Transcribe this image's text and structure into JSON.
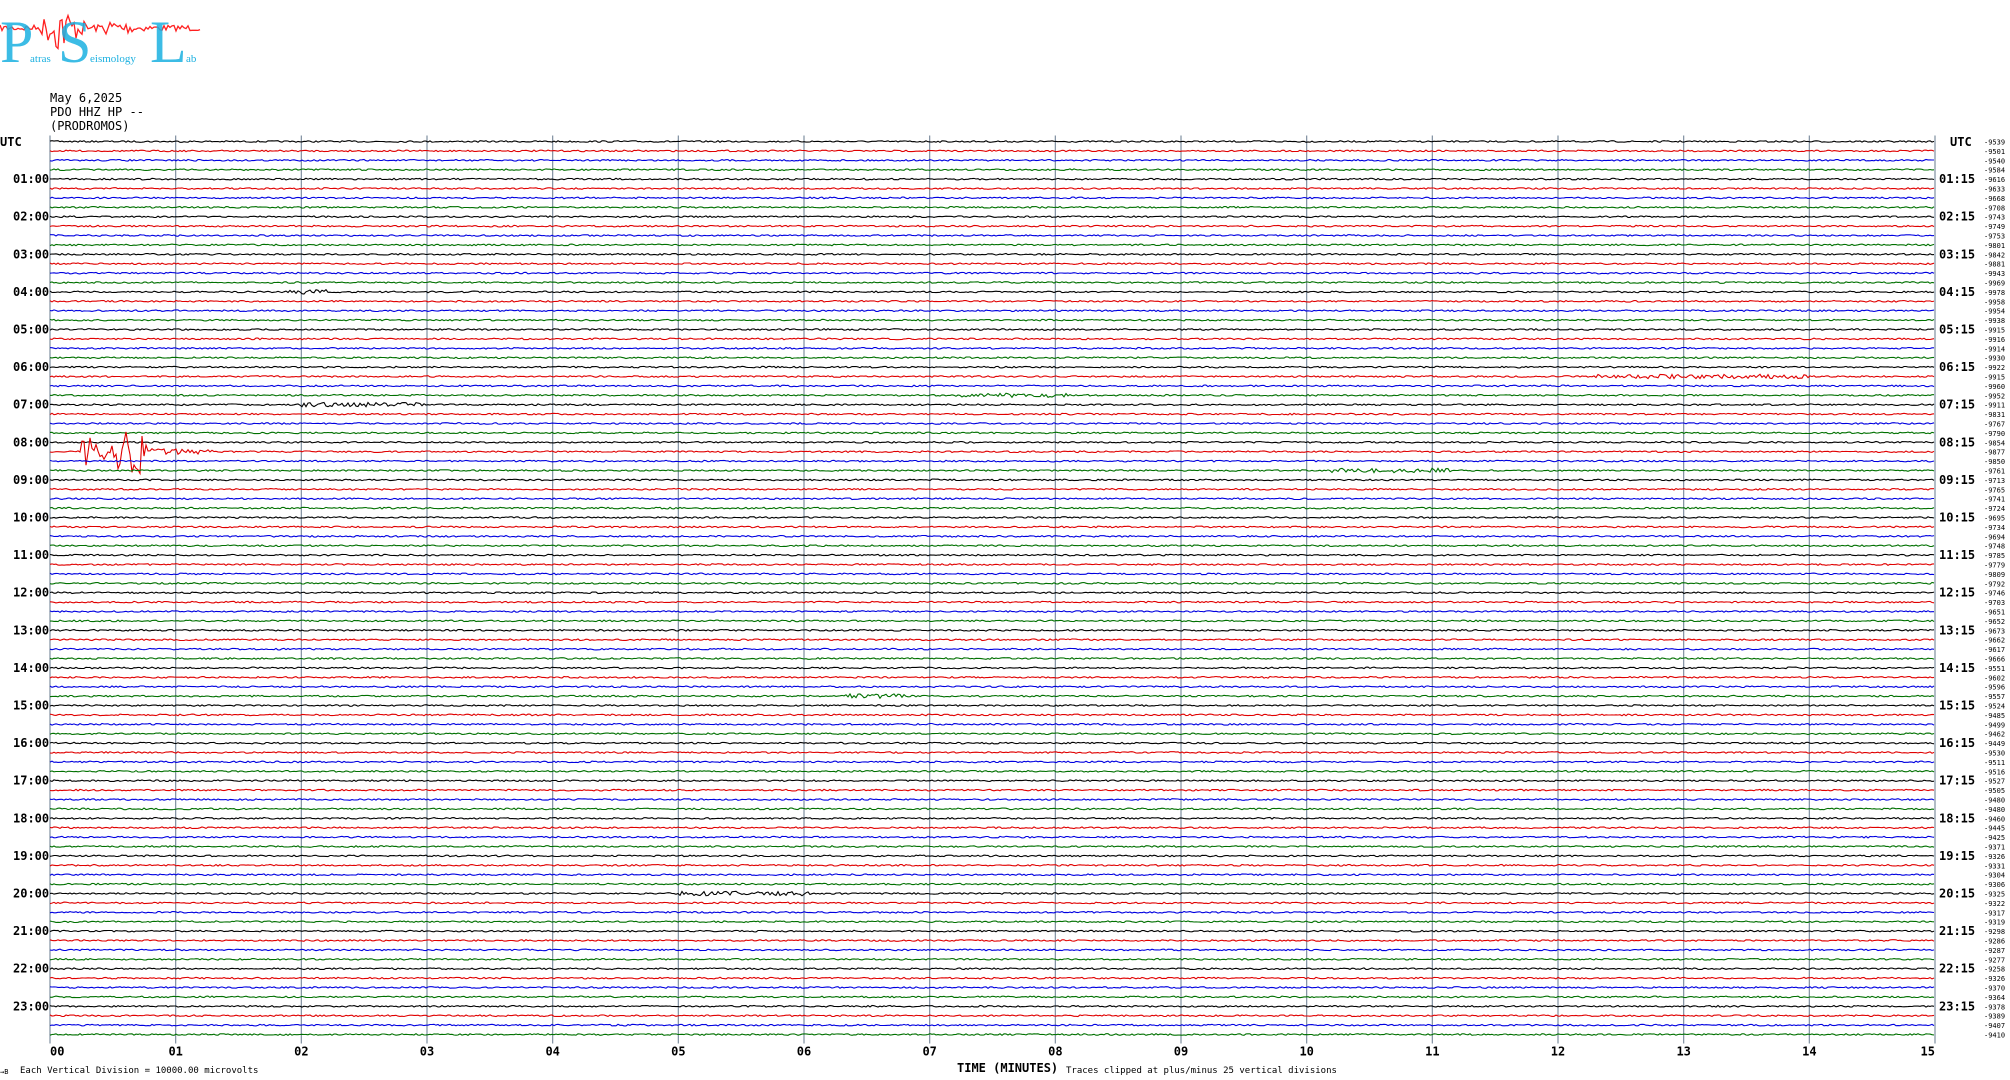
{
  "logo": {
    "big": [
      "P",
      "S",
      "L"
    ],
    "small": [
      "atras",
      "eismology",
      "ab"
    ]
  },
  "header": {
    "date": "May 6,2025",
    "station": "PDO HHZ HP --",
    "site": "(PRODROMOS)"
  },
  "colors": {
    "trace_cycle": [
      "#000000",
      "#e00000",
      "#0000e0",
      "#007000"
    ],
    "grid": "#7f8fa0",
    "logo_red": "#ff2020",
    "logo_blue": "#1ab0e0"
  },
  "chart_data": {
    "type": "helicorder",
    "utc_label_left": "UTC",
    "utc_label_right": "UTC",
    "row_count": 96,
    "xlabel": "TIME (MINUTES)",
    "x_ticks": [
      "00",
      "01",
      "02",
      "03",
      "04",
      "05",
      "06",
      "07",
      "08",
      "09",
      "10",
      "11",
      "12",
      "13",
      "14",
      "15"
    ],
    "left_hour_labels": [
      "01:00",
      "02:00",
      "03:00",
      "04:00",
      "05:00",
      "06:00",
      "07:00",
      "08:00",
      "09:00",
      "10:00",
      "11:00",
      "12:00",
      "13:00",
      "14:00",
      "15:00",
      "16:00",
      "17:00",
      "18:00",
      "19:00",
      "20:00",
      "21:00",
      "22:00",
      "23:00"
    ],
    "right_hour_labels": [
      "01:15",
      "02:15",
      "03:15",
      "04:15",
      "05:15",
      "06:15",
      "07:15",
      "08:15",
      "09:15",
      "10:15",
      "11:15",
      "12:15",
      "13:15",
      "14:15",
      "15:15",
      "16:15",
      "17:15",
      "18:15",
      "19:15",
      "20:15",
      "21:15",
      "22:15",
      "23:15"
    ],
    "row_values": [
      "-9539",
      "-9501",
      "-9540",
      "-9584",
      "-9616",
      "-9633",
      "-9668",
      "-9708",
      "-9743",
      "-9749",
      "-9753",
      "-9801",
      "-9842",
      "-9881",
      "-9943",
      "-9969",
      "-9978",
      "-9958",
      "-9954",
      "-9938",
      "-9915",
      "-9916",
      "-9914",
      "-9930",
      "-9922",
      "-9915",
      "-9960",
      "-9952",
      "-9911",
      "-9831",
      "-9767",
      "-9790",
      "-9854",
      "-9877",
      "-9850",
      "-9761",
      "-9713",
      "-9765",
      "-9741",
      "-9724",
      "-9695",
      "-9734",
      "-9694",
      "-9748",
      "-9785",
      "-9779",
      "-9809",
      "-9792",
      "-9746",
      "-9703",
      "-9651",
      "-9652",
      "-9673",
      "-9662",
      "-9617",
      "-9666",
      "-9551",
      "-9602",
      "-9596",
      "-9557",
      "-9524",
      "-9485",
      "-9499",
      "-9462",
      "-9449",
      "-9530",
      "-9511",
      "-9516",
      "-9527",
      "-9505",
      "-9480",
      "-9480",
      "-9460",
      "-9445",
      "-9425",
      "-9371",
      "-9326",
      "-9331",
      "-9304",
      "-9306",
      "-9325",
      "-9322",
      "-9317",
      "-9319",
      "-9298",
      "-9286",
      "-9287",
      "-9277",
      "-9258",
      "-9326",
      "-9370",
      "-9364",
      "-9378",
      "-9389",
      "-9407",
      "-9410"
    ],
    "events": [
      {
        "row": 33,
        "start_min": 0.25,
        "end_min": 1.3,
        "peak_min": 0.65,
        "amplitude": "large"
      },
      {
        "row": 28,
        "start_min": 2.0,
        "end_min": 3.0,
        "amplitude": "small"
      },
      {
        "row": 27,
        "start_min": 7.2,
        "end_min": 8.1,
        "amplitude": "small"
      },
      {
        "row": 35,
        "start_min": 10.2,
        "end_min": 11.2,
        "amplitude": "small"
      },
      {
        "row": 25,
        "start_min": 12.3,
        "end_min": 14.0,
        "amplitude": "small"
      },
      {
        "row": 59,
        "start_min": 6.3,
        "end_min": 6.8,
        "amplitude": "small"
      },
      {
        "row": 80,
        "start_min": 5.0,
        "end_min": 6.1,
        "amplitude": "small"
      },
      {
        "row": 16,
        "start_min": 1.9,
        "end_min": 2.2,
        "amplitude": "small"
      }
    ]
  },
  "footer": {
    "left_small": "→B",
    "division_note": "Each Vertical Division = 10000.00 microvolts",
    "clip_note": "Traces clipped at plus/minus 25 vertical divisions"
  }
}
